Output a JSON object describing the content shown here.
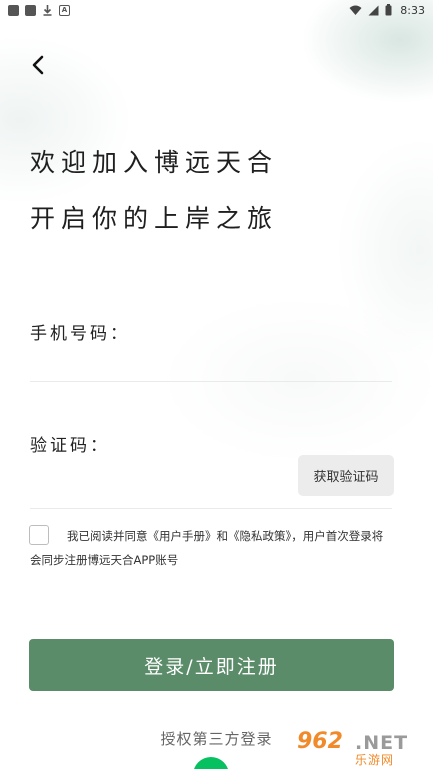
{
  "status_bar": {
    "time": "8:33",
    "left_icons": [
      "app-square-icon",
      "app-square-icon",
      "download-icon",
      "a-badge-icon"
    ],
    "right_icons": [
      "wifi-icon",
      "signal-icon",
      "battery-icon"
    ]
  },
  "header": {
    "back_icon": "chevron-left-icon"
  },
  "headline": {
    "line1": "欢迎加入博远天合",
    "line2": "开启你的上岸之旅"
  },
  "form": {
    "phone_label": "手机号码：",
    "phone_value": "",
    "code_label": "验证码：",
    "code_value": "",
    "get_code_label": "获取验证码"
  },
  "agreement": {
    "checked": false,
    "prefix": "我已阅读并同意",
    "user_manual": "《用户手册》",
    "and": "和",
    "privacy_policy": "《隐私政策》",
    "suffix": "，用户首次登录将会同步注册博远天合APP账号"
  },
  "submit_label": "登录/立即注册",
  "third_party_label": "授权第三方登录",
  "third_party_icon": "wechat-icon",
  "watermark": {
    "number": "962",
    "net": ".NET",
    "cn": "乐游网"
  },
  "colors": {
    "primary": "#5b8c69",
    "get_code_bg": "#ececec",
    "wechat": "#07c160",
    "watermark_orange": "#f08a2a"
  }
}
